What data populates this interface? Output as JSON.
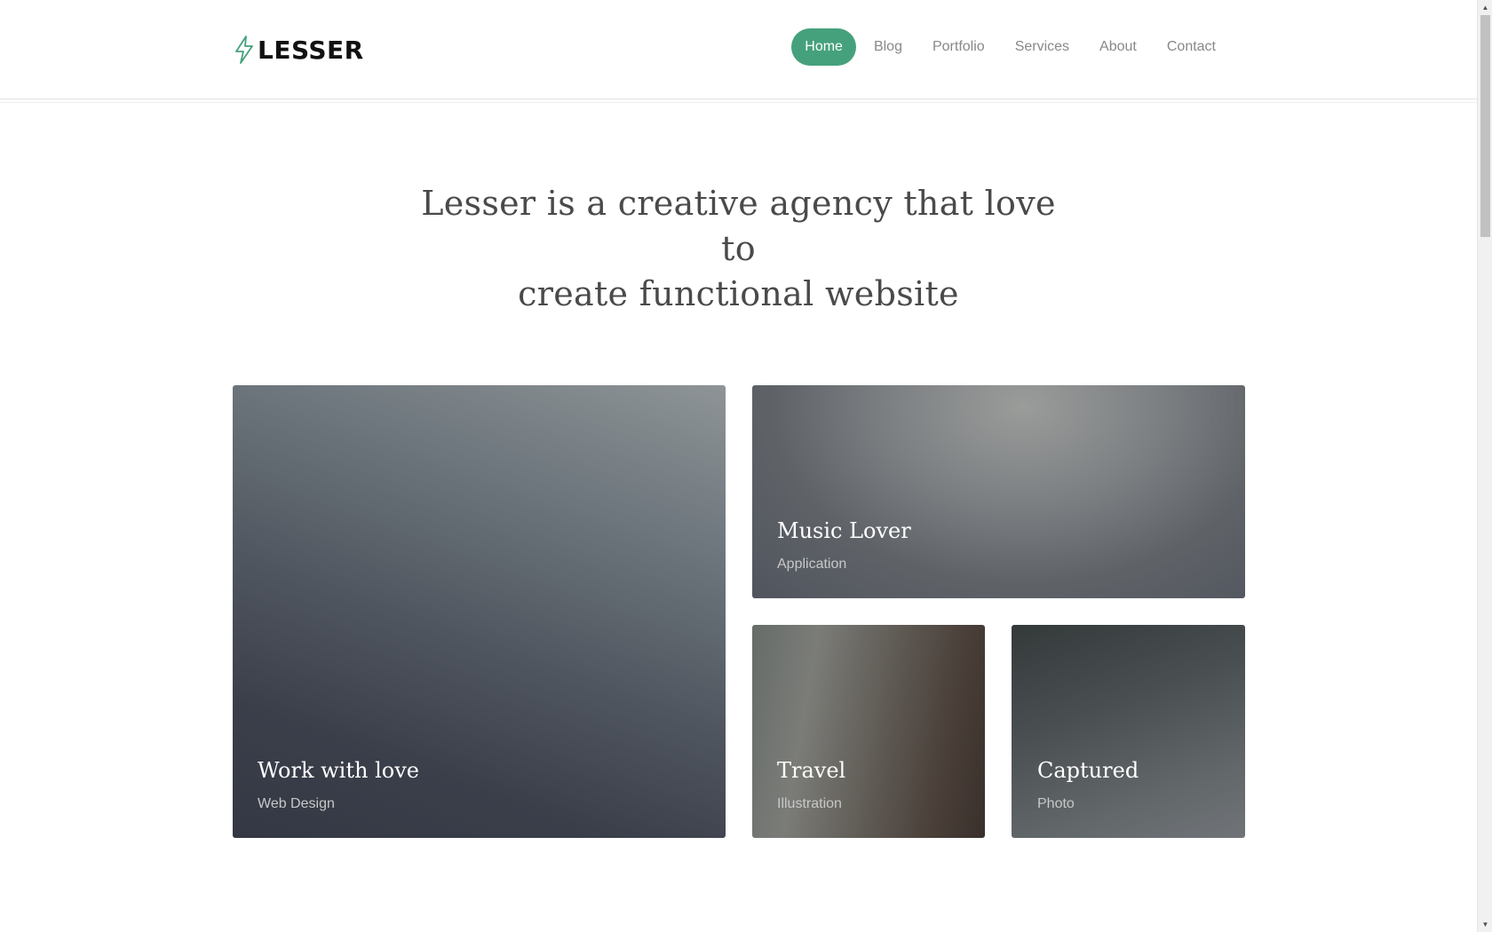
{
  "brand": {
    "name": "LESSER",
    "icon": "lightning-bolt-icon",
    "accent": "#45a17c"
  },
  "nav": {
    "items": [
      {
        "label": "Home",
        "active": true
      },
      {
        "label": "Blog",
        "active": false
      },
      {
        "label": "Portfolio",
        "active": false
      },
      {
        "label": "Services",
        "active": false
      },
      {
        "label": "About",
        "active": false
      },
      {
        "label": "Contact",
        "active": false
      }
    ]
  },
  "hero": {
    "line1": "Lesser is a creative agency that love to",
    "line2": "create functional website"
  },
  "portfolio": {
    "items": [
      {
        "title": "Work with love",
        "category": "Web Design"
      },
      {
        "title": "Music Lover",
        "category": "Application"
      },
      {
        "title": "Travel",
        "category": "Illustration"
      },
      {
        "title": "Captured",
        "category": "Photo"
      }
    ]
  },
  "scrollbar": {
    "up_icon": "triangle-up-icon",
    "down_icon": "triangle-down-icon"
  }
}
